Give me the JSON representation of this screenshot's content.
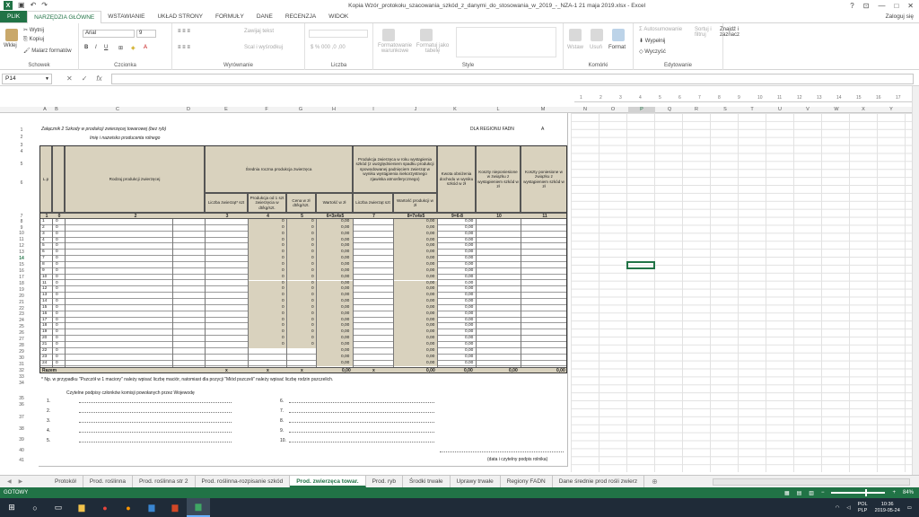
{
  "window": {
    "title": "Kopia Wzór_protokołu_szacowania_szkód_z_danymi_do_stosowania_w_2019_-_NZA-1 21 maja 2019.xlsx - Excel",
    "login": "Zaloguj się",
    "controls": [
      "?",
      "⊡",
      "—",
      "□",
      "✕"
    ]
  },
  "quick_access": {
    "undo": "↶",
    "redo": "↷"
  },
  "ribbon_tabs": [
    "PLIK",
    "NARZĘDZIA GŁÓWNE",
    "WSTAWIANIE",
    "UKŁAD STRONY",
    "FORMUŁY",
    "DANE",
    "RECENZJA",
    "WIDOK"
  ],
  "ribbon": {
    "clipboard": {
      "label": "Schowek",
      "paste": "Wklej",
      "cut": "Wytnij",
      "copy": "Kopiuj",
      "painter": "Malarz formatów"
    },
    "font": {
      "label": "Czcionka",
      "name": "Arial",
      "size": "9"
    },
    "alignment": {
      "label": "Wyrównanie",
      "wrap": "Zawijaj tekst",
      "merge": "Scal i wyśrodkuj"
    },
    "number": {
      "label": "Liczba"
    },
    "styles": {
      "label": "Style",
      "cond": "Formatowanie warunkowe",
      "table": "Formatuj jako tabelę"
    },
    "cells": {
      "label": "Komórki",
      "insert": "Wstaw",
      "delete": "Usuń",
      "format": "Format"
    },
    "editing": {
      "label": "Edytowanie",
      "autosum": "Autosumowanie",
      "fill": "Wypełnij",
      "clear": "Wyczyść",
      "sort": "Sortuj i filtruj",
      "find": "Znajdź i zaznacz"
    }
  },
  "formula_bar": {
    "name_box": "P14",
    "fx": "fx",
    "cancel": "✕",
    "enter": "✓",
    "value": ""
  },
  "column_headers": [
    "A",
    "B",
    "C",
    "D",
    "E",
    "F",
    "G",
    "H",
    "I",
    "J",
    "K",
    "L",
    "M",
    "N",
    "O",
    "P",
    "Q",
    "R",
    "S",
    "T",
    "U",
    "V",
    "W",
    "X",
    "Y"
  ],
  "selected_column": "P",
  "selected_row": "14",
  "ruler_numbers": [
    "1",
    "2",
    "3",
    "4",
    "5",
    "6",
    "7",
    "8",
    "9",
    "10",
    "11",
    "12",
    "13",
    "14",
    "15",
    "16",
    "17"
  ],
  "row_numbers": [
    "1",
    "2",
    "3",
    "4",
    "5",
    "6",
    "7",
    "8",
    "9",
    "10",
    "11",
    "12",
    "13",
    "14",
    "15",
    "16",
    "17",
    "18",
    "19",
    "20",
    "21",
    "22",
    "23",
    "24",
    "25",
    "26",
    "27",
    "28",
    "29",
    "30",
    "31",
    "32",
    "33",
    "34",
    "35",
    "36",
    "37",
    "38",
    "39",
    "40",
    "41"
  ],
  "doc": {
    "annex": "Załącznik  2 Szkody w produkcji zwierzęcej towarowej (bez ryb)",
    "fadn": "DLA REGIONU FADN",
    "fadn_val": "A",
    "producer": "Imię i nazwisko producenta rolnego",
    "h_lp": "L.p",
    "h_type": "Rodzaj produkcji zwierzęcej",
    "h_avg": "Średnia roczna produkcja zwierzęca",
    "h_occ": "Produkcja zwierzęca w roku wystąpienia szkód (z uwzględnieniem spadku produkcji spowodowanej padnięciem zwierząt w wyniku wystąpienia niekorzystnego zjawiska atmosferycznego)",
    "h_kwota": "Kwota obniżenia dochodu w wyniku szkód w zł",
    "h_koszty_nie": "Koszty nieponiesione w związku z wystąpieniem szkód w zł",
    "h_koszty_pon": "Koszty poniesione w związku z wystąpieniem szkód w zł",
    "s_count": "Liczba zwierząt* szt",
    "s_prod": "Produkcja od 1 szt zwierzęcia w dt/kg/szt.",
    "s_price": "Cena w zł dt/kg/szt.",
    "s_value": "Wartość w zł",
    "s_count2": "Liczba zwierząt szt",
    "s_value2": "Wartość produkcji w zł",
    "n": [
      "1",
      "0",
      "2",
      "3",
      "4",
      "5",
      "6=3x4x5",
      "7",
      "8=7x4x5",
      "9=6-8",
      "10",
      "11"
    ],
    "sum": {
      "label": "Razem",
      "e": "x",
      "f": "x",
      "g": "x",
      "h": "0,00",
      "i": "x",
      "j": "0,00",
      "k": "0,00",
      "l": "0,00",
      "m": "0,00"
    },
    "footnote": "* Np. w przypadku \"Pszczół w 1 maciory\" należy wpisać liczbę maciór, natomiast dla pozycji \"Miód pszczeli\" należy wpisać liczbę rodzin pszczelich.",
    "signatures_title": "Czytelne podpisy członków komisji powołanych przez Wojewodę",
    "sig_left": [
      "1.",
      "2.",
      "3.",
      "4.",
      "5."
    ],
    "sig_right": [
      "6.",
      "7.",
      "8.",
      "9.",
      "10."
    ],
    "farmer_sig": "(data i czytelny podpis rolnika)"
  },
  "rows": [
    {
      "lp": "1",
      "b": "0",
      "f": "0",
      "g": "0",
      "h": "0,00",
      "j": "0,00",
      "k": "0,00"
    },
    {
      "lp": "2",
      "b": "0",
      "f": "0",
      "g": "0",
      "h": "0,00",
      "j": "0,00",
      "k": "0,00"
    },
    {
      "lp": "3",
      "b": "0",
      "f": "0",
      "g": "0",
      "h": "0,00",
      "j": "0,00",
      "k": "0,00"
    },
    {
      "lp": "4",
      "b": "0",
      "f": "0",
      "g": "0",
      "h": "0,00",
      "j": "0,00",
      "k": "0,00"
    },
    {
      "lp": "5",
      "b": "0",
      "f": "0",
      "g": "0",
      "h": "0,00",
      "j": "0,00",
      "k": "0,00"
    },
    {
      "lp": "6",
      "b": "0",
      "f": "0",
      "g": "0",
      "h": "0,00",
      "j": "0,00",
      "k": "0,00"
    },
    {
      "lp": "7",
      "b": "0",
      "f": "0",
      "g": "0",
      "h": "0,00",
      "j": "0,00",
      "k": "0,00"
    },
    {
      "lp": "8",
      "b": "0",
      "f": "0",
      "g": "0",
      "h": "0,00",
      "j": "0,00",
      "k": "0,00"
    },
    {
      "lp": "9",
      "b": "0",
      "f": "0",
      "g": "0",
      "h": "0,00",
      "j": "0,00",
      "k": "0,00"
    },
    {
      "lp": "10",
      "b": "0",
      "f": "0",
      "g": "0",
      "h": "0,00",
      "j": "0,00",
      "k": "0,00"
    },
    {
      "lp": "11",
      "b": "0",
      "f": "0",
      "g": "0",
      "h": "0,00",
      "j": "0,00",
      "k": "0,00"
    },
    {
      "lp": "12",
      "b": "0",
      "f": "0",
      "g": "0",
      "h": "0,00",
      "j": "0,00",
      "k": "0,00"
    },
    {
      "lp": "13",
      "b": "0",
      "f": "0",
      "g": "0",
      "h": "0,00",
      "j": "0,00",
      "k": "0,00"
    },
    {
      "lp": "14",
      "b": "0",
      "f": "0",
      "g": "0",
      "h": "0,00",
      "j": "0,00",
      "k": "0,00"
    },
    {
      "lp": "15",
      "b": "0",
      "f": "0",
      "g": "0",
      "h": "0,00",
      "j": "0,00",
      "k": "0,00"
    },
    {
      "lp": "16",
      "b": "0",
      "f": "0",
      "g": "0",
      "h": "0,00",
      "j": "0,00",
      "k": "0,00"
    },
    {
      "lp": "17",
      "b": "0",
      "f": "0",
      "g": "0",
      "h": "0,00",
      "j": "0,00",
      "k": "0,00"
    },
    {
      "lp": "18",
      "b": "0",
      "f": "0",
      "g": "0",
      "h": "0,00",
      "j": "0,00",
      "k": "0,00"
    },
    {
      "lp": "19",
      "b": "0",
      "f": "0",
      "g": "0",
      "h": "0,00",
      "j": "0,00",
      "k": "0,00"
    },
    {
      "lp": "20",
      "b": "0",
      "f": "0",
      "g": "0",
      "h": "0,00",
      "j": "0,00",
      "k": "0,00"
    },
    {
      "lp": "21",
      "b": "0",
      "f": "0",
      "g": "0",
      "h": "0,00",
      "j": "0,00",
      "k": "0,00"
    },
    {
      "lp": "22",
      "b": "0",
      "f": "",
      "g": "",
      "h": "0,00",
      "j": "0,00",
      "k": "0,00"
    },
    {
      "lp": "23",
      "b": "0",
      "f": "",
      "g": "",
      "h": "0,00",
      "j": "0,00",
      "k": "0,00"
    },
    {
      "lp": "24",
      "b": "0",
      "f": "",
      "g": "",
      "h": "0,00",
      "j": "0,00",
      "k": "0,00"
    }
  ],
  "sheet_tabs": [
    "Protokół",
    "Prod. roślinna",
    "Prod. roślinna str 2",
    "Prod. roślinna-rozpisanie szkód",
    "Prod. zwierzęca towar.",
    "Prod. ryb",
    "Środki trwałe",
    "Uprawy trwałe",
    "Regiony FADN",
    "Dane średnie prod rośli zwierz"
  ],
  "active_sheet": "Prod. zwierzęca towar.",
  "status": {
    "ready": "GOTOWY",
    "zoom": "84%"
  },
  "taskbar": {
    "lang": "POL",
    "layout": "PLP",
    "time": "10:36",
    "date": "2019-05-24"
  }
}
